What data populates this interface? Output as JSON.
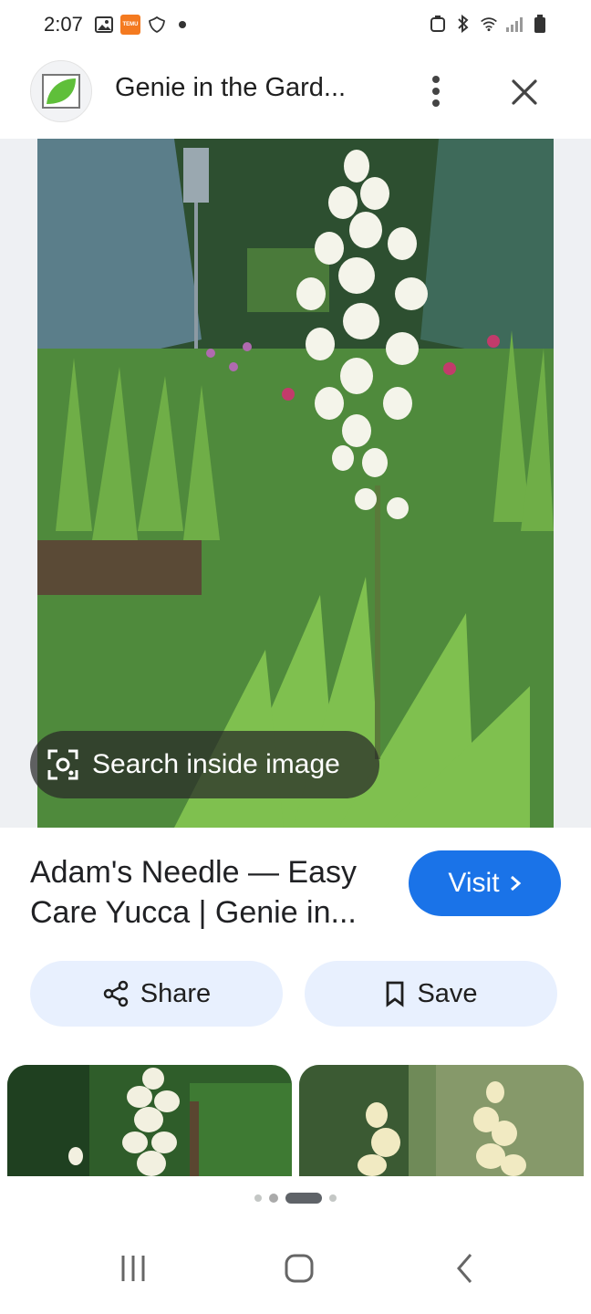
{
  "status_bar": {
    "time": "2:07",
    "left_icons": [
      "gallery-icon",
      "temu-app-icon",
      "shield-icon",
      "notification-dot-icon"
    ],
    "temu_badge_text": "TEMU",
    "right_icons": [
      "battery-saver-icon",
      "bluetooth-icon",
      "wifi-icon",
      "signal-icon",
      "battery-icon"
    ]
  },
  "header": {
    "title": "Genie in the Gard...",
    "favicon_color": "#5fbf3a",
    "icons": [
      "more-vert-icon",
      "close-icon"
    ]
  },
  "image_viewer": {
    "search_inside_label": "Search inside image"
  },
  "result": {
    "title": "Adam's Needle — Easy Care Yucca | Genie in...",
    "visit_label": "Visit",
    "share_label": "Share",
    "save_label": "Save"
  },
  "colors": {
    "accent": "#1a73e8",
    "chip_bg": "#e8f0fe",
    "overlay": "#282828"
  },
  "pager": {
    "active_index": 2,
    "count": 4
  },
  "nav_bar": {
    "icons": [
      "recent-apps-icon",
      "home-icon",
      "back-icon"
    ]
  }
}
